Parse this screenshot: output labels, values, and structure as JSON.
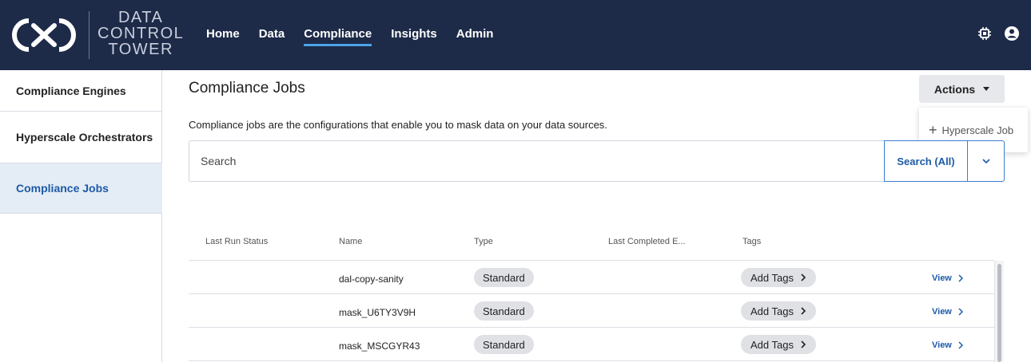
{
  "brand": {
    "logo_icon": "cx-logo-icon",
    "line1": "DATA",
    "line2": "CONTROL",
    "line3": "TOWER"
  },
  "nav": {
    "items": [
      "Home",
      "Data",
      "Compliance",
      "Insights",
      "Admin"
    ],
    "active": "Compliance"
  },
  "top_icons": [
    "settings-chip-icon",
    "user-account-icon"
  ],
  "sidebar": {
    "items": [
      {
        "label": "Compliance Engines"
      },
      {
        "label": "Hyperscale Orchestrators"
      },
      {
        "label": "Compliance Jobs",
        "active": true
      }
    ]
  },
  "main": {
    "title": "Compliance Jobs",
    "description": "Compliance jobs are the configurations that enable you to mask data on your data sources.",
    "actions_label": "Actions",
    "actions_menu": [
      {
        "label": "Hyperscale Job",
        "icon": "plus-icon"
      }
    ],
    "search": {
      "placeholder": "Search",
      "button_label": "Search (All)"
    }
  },
  "table": {
    "columns": [
      "Last Run Status",
      "Name",
      "Type",
      "Last Completed E...",
      "Tags"
    ],
    "rows": [
      {
        "status": "",
        "name": "dal-copy-sanity",
        "type": "Standard",
        "last_completed": "",
        "tags": "Add Tags",
        "view": "View"
      },
      {
        "status": "",
        "name": "mask_U6TY3V9H",
        "type": "Standard",
        "last_completed": "",
        "tags": "Add Tags",
        "view": "View"
      },
      {
        "status": "",
        "name": "mask_MSCGYR43",
        "type": "Standard",
        "last_completed": "",
        "tags": "Add Tags",
        "view": "View"
      }
    ]
  },
  "colors": {
    "topbar": "#1d2a48",
    "accent": "#1d5aa8",
    "nav_underline": "#4ea3e8",
    "sidebar_active_bg": "#e4ecf5"
  }
}
